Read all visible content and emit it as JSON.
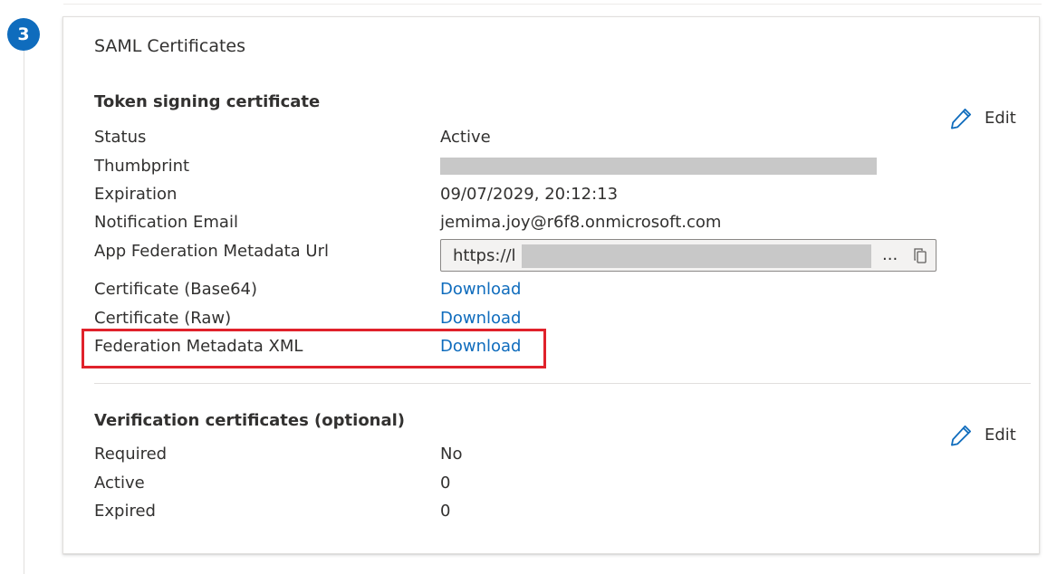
{
  "step": {
    "number": "3"
  },
  "card": {
    "title": "SAML Certificates"
  },
  "token": {
    "title": "Token signing certificate",
    "edit_label": "Edit",
    "rows": {
      "status": {
        "label": "Status",
        "value": "Active"
      },
      "thumbprint": {
        "label": "Thumbprint"
      },
      "expiration": {
        "label": "Expiration",
        "value": "09/07/2029, 20:12:13"
      },
      "email": {
        "label": "Notification Email",
        "value": "jemima.joy@r6f8.onmicrosoft.com"
      },
      "metadata_url": {
        "label": "App Federation Metadata Url",
        "value": "https://l",
        "ellipsis": "..."
      },
      "cert_base64": {
        "label": "Certificate (Base64)",
        "link": "Download"
      },
      "cert_raw": {
        "label": "Certificate (Raw)",
        "link": "Download"
      },
      "fed_xml": {
        "label": "Federation Metadata XML",
        "link": "Download"
      }
    }
  },
  "verification": {
    "title": "Verification certificates (optional)",
    "edit_label": "Edit",
    "rows": {
      "required": {
        "label": "Required",
        "value": "No"
      },
      "active": {
        "label": "Active",
        "value": "0"
      },
      "expired": {
        "label": "Expired",
        "value": "0"
      }
    }
  },
  "colors": {
    "accent": "#0f6cbd",
    "highlight": "#e0222b",
    "redaction": "#c8c8c8"
  },
  "icons": {
    "edit": "pencil-icon",
    "copy": "copy-icon"
  }
}
